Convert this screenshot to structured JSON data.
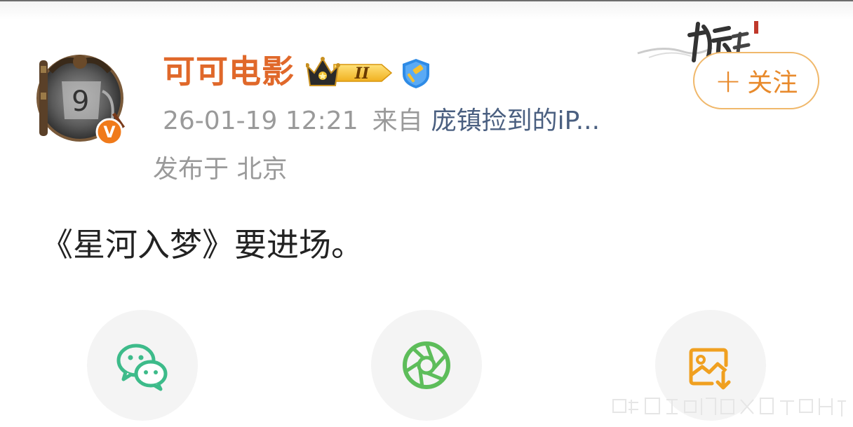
{
  "post": {
    "username": "可可电影",
    "date": "26-01-19 12:21",
    "source_prefix": "来自",
    "source_device": "庞镇捡到的iP...",
    "location": "发布于 北京",
    "content": "《星河入梦》要进场。"
  },
  "badges": {
    "crown_level": "II",
    "crown_icon": "crown-icon",
    "verify_icon": "gavel-shield-icon",
    "avatar_verified_mark": "V"
  },
  "follow": {
    "plus": "+",
    "label": "关注"
  },
  "share_targets": [
    {
      "icon": "wechat-icon",
      "color": "#3dbb8a"
    },
    {
      "icon": "moments-aperture-icon",
      "color": "#5dbd5a"
    },
    {
      "icon": "save-image-icon",
      "color": "#f0a020"
    }
  ],
  "colors": {
    "username": "#e0682a",
    "source_link": "#4a5f80",
    "follow_accent": "#e88a2c",
    "meta_gray": "#9a9a9a"
  }
}
